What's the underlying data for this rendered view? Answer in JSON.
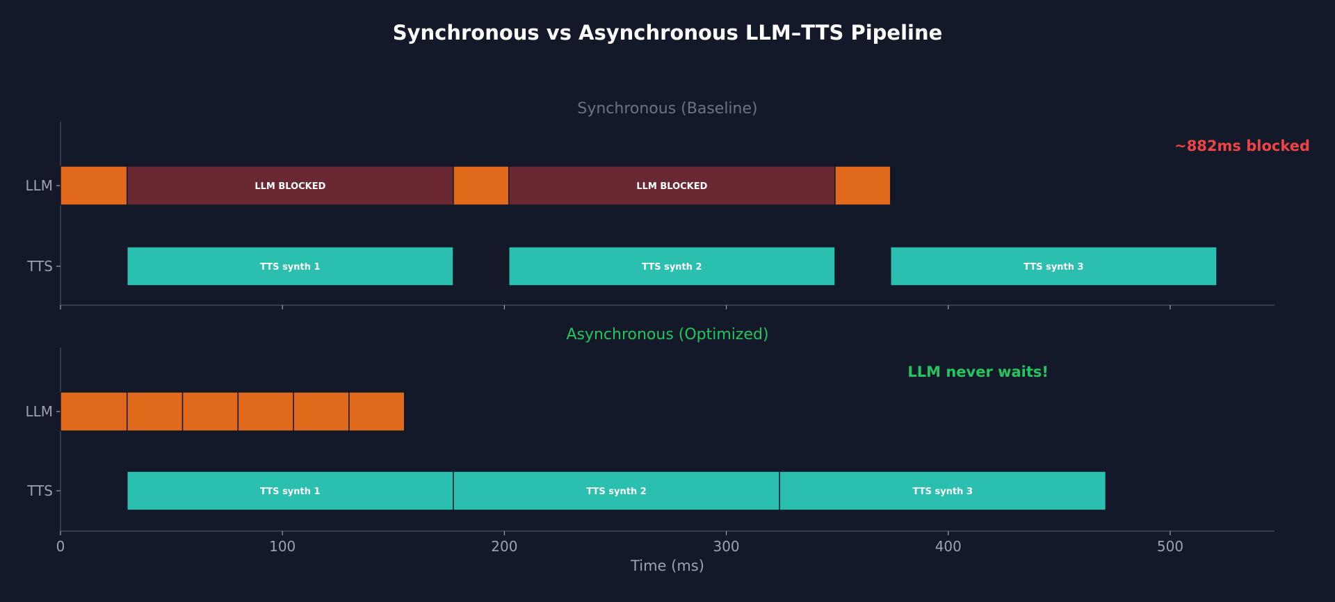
{
  "title": "Synchronous vs Asynchronous LLM–TTS Pipeline",
  "colors": {
    "background": "#131929",
    "llm": "#e1691b",
    "blocked": "#6a2833",
    "tts": "#2bbfb0",
    "axis": "#4a5263",
    "tick_label": "#9aa3b2",
    "title": "#ffffff",
    "bar_text": "#ffffff"
  },
  "chart_data": [
    {
      "type": "gantt",
      "subtitle": "Synchronous (Baseline)",
      "subtitle_color": "#6b7384",
      "annotation": {
        "text": "~882ms blocked",
        "color": "#ef4444",
        "placement": "top-right"
      },
      "rows": [
        "LLM",
        "TTS"
      ],
      "xlim": [
        0,
        547
      ],
      "xticks": [
        0,
        100,
        200,
        300,
        400,
        500
      ],
      "tick_labels_shown": false,
      "segments": [
        {
          "row": "LLM",
          "start": 0,
          "end": 30,
          "kind": "llm",
          "label": ""
        },
        {
          "row": "LLM",
          "start": 30,
          "end": 177,
          "kind": "blocked",
          "label": "LLM BLOCKED"
        },
        {
          "row": "LLM",
          "start": 177,
          "end": 202,
          "kind": "llm",
          "label": ""
        },
        {
          "row": "LLM",
          "start": 202,
          "end": 349,
          "kind": "blocked",
          "label": "LLM BLOCKED"
        },
        {
          "row": "LLM",
          "start": 349,
          "end": 374,
          "kind": "llm",
          "label": ""
        },
        {
          "row": "TTS",
          "start": 30,
          "end": 177,
          "kind": "tts",
          "label": "TTS synth 1"
        },
        {
          "row": "TTS",
          "start": 202,
          "end": 349,
          "kind": "tts",
          "label": "TTS synth 2"
        },
        {
          "row": "TTS",
          "start": 374,
          "end": 521,
          "kind": "tts",
          "label": "TTS synth 3"
        }
      ]
    },
    {
      "type": "gantt",
      "subtitle": "Asynchronous (Optimized)",
      "subtitle_color": "#22c55e",
      "annotation": {
        "text": "LLM never waits!",
        "color": "#22c55e",
        "placement": "top-right"
      },
      "rows": [
        "LLM",
        "TTS"
      ],
      "xlim": [
        0,
        547
      ],
      "xticks": [
        0,
        100,
        200,
        300,
        400,
        500
      ],
      "tick_labels_shown": true,
      "xlabel": "Time (ms)",
      "segments": [
        {
          "row": "LLM",
          "start": 0,
          "end": 30,
          "kind": "llm",
          "label": ""
        },
        {
          "row": "LLM",
          "start": 30,
          "end": 55,
          "kind": "llm",
          "label": ""
        },
        {
          "row": "LLM",
          "start": 55,
          "end": 80,
          "kind": "llm",
          "label": ""
        },
        {
          "row": "LLM",
          "start": 80,
          "end": 105,
          "kind": "llm",
          "label": ""
        },
        {
          "row": "LLM",
          "start": 105,
          "end": 130,
          "kind": "llm",
          "label": ""
        },
        {
          "row": "LLM",
          "start": 130,
          "end": 155,
          "kind": "llm",
          "label": ""
        },
        {
          "row": "TTS",
          "start": 30,
          "end": 177,
          "kind": "tts",
          "label": "TTS synth 1"
        },
        {
          "row": "TTS",
          "start": 177,
          "end": 324,
          "kind": "tts",
          "label": "TTS synth 2"
        },
        {
          "row": "TTS",
          "start": 324,
          "end": 471,
          "kind": "tts",
          "label": "TTS synth 3"
        }
      ]
    }
  ]
}
